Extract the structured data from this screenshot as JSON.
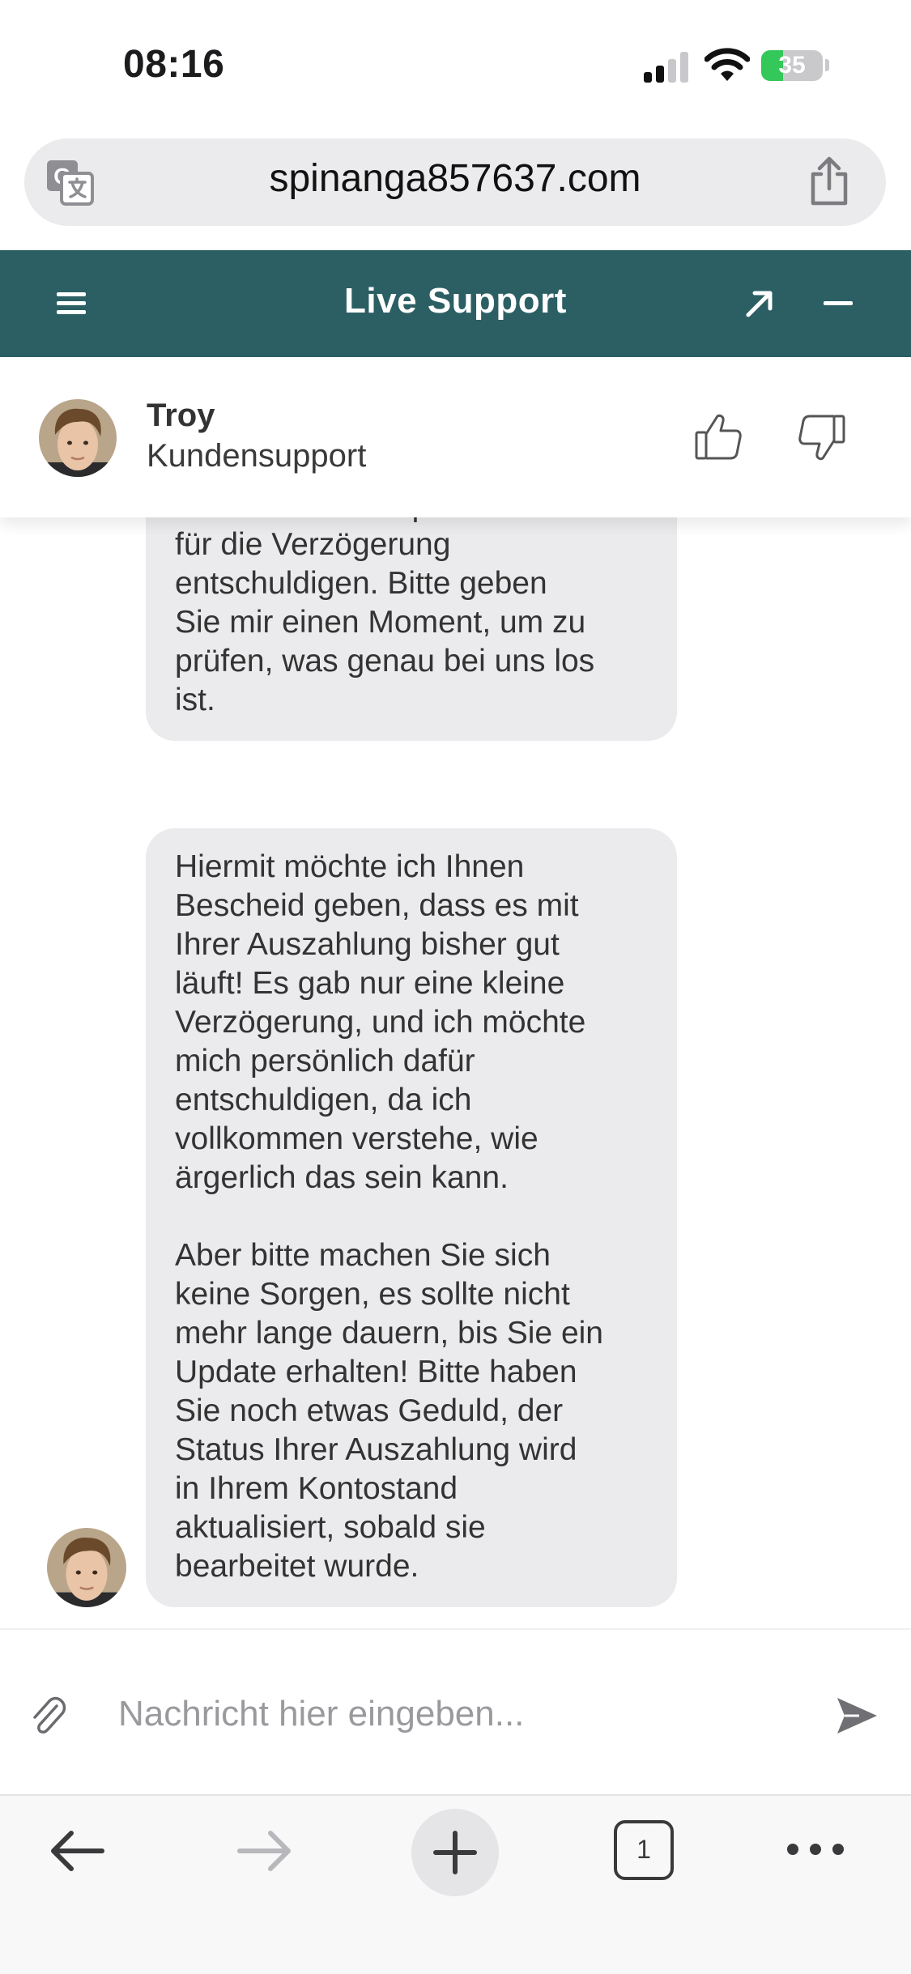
{
  "status_bar": {
    "time": "08:16",
    "battery": "35",
    "battery_level": 0.35
  },
  "browser": {
    "url": "spinanga857637.com"
  },
  "chat": {
    "title": "Live Support",
    "agent": {
      "name": "Troy",
      "role": "Kundensupport"
    },
    "messages": [
      {
        "text": "Geld dringend erwarten, und\nich möchte mich persönlich\nfür die Verzögerung\nentschuldigen. Bitte geben\nSie mir einen Moment, um zu\nprüfen, was genau bei uns los\nist."
      },
      {
        "text": "Hiermit möchte ich Ihnen\nBescheid geben, dass es mit\nIhrer Auszahlung bisher gut\nläuft! Es gab nur eine kleine\nVerzögerung, und ich möchte\nmich persönlich dafür\nentschuldigen, da ich\nvollkommen verstehe, wie\närgerlich das sein kann.\n\nAber bitte machen Sie sich\nkeine Sorgen, es sollte nicht\nmehr lange dauern, bis Sie ein\nUpdate erhalten! Bitte haben\nSie noch etwas Geduld, der\nStatus Ihrer Auszahlung wird\nin Ihrem Kontostand\naktualisiert, sobald sie\nbearbeitet wurde."
      }
    ],
    "input": {
      "placeholder": "Nachricht hier eingeben...",
      "value": ""
    }
  },
  "toolbar": {
    "tab_count": "1"
  },
  "colors": {
    "header": "#2b5f64",
    "bubble": "#ebebed",
    "battery_fill": "#34c759"
  },
  "icons": [
    "translate-icon",
    "share-icon",
    "menu-icon",
    "expand-icon",
    "minimize-icon",
    "thumbs-up-icon",
    "thumbs-down-icon",
    "paperclip-icon",
    "send-icon",
    "back-arrow-icon",
    "forward-arrow-icon",
    "plus-icon",
    "more-icon"
  ]
}
